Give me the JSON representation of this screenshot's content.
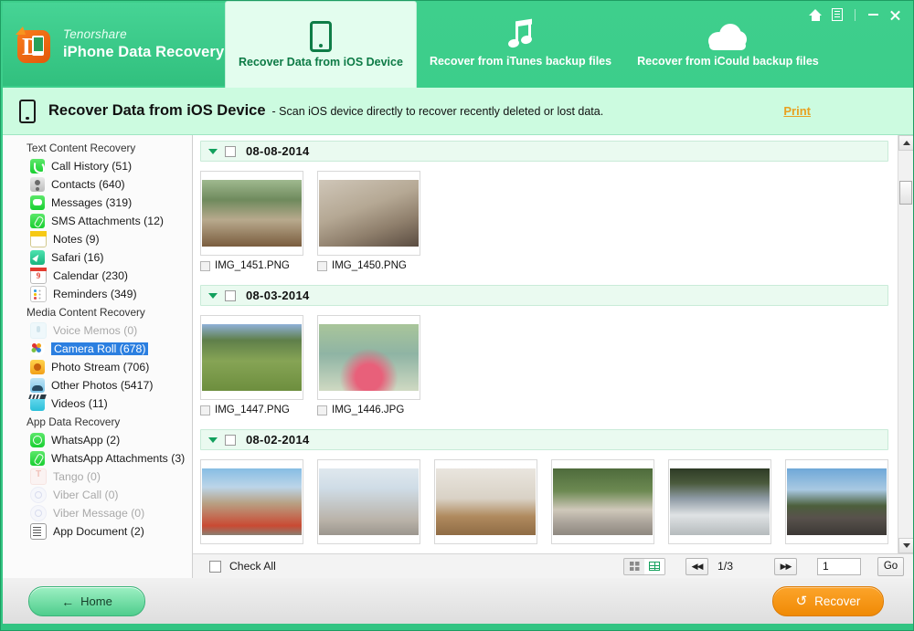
{
  "brand": {
    "company": "Tenorshare",
    "product": "iPhone Data Recovery",
    "logo_icon": "tenorshare-d-logo-icon"
  },
  "window_controls": [
    {
      "name": "home-icon",
      "label": ""
    },
    {
      "name": "document-icon",
      "label": ""
    },
    {
      "name": "minimize-icon",
      "label": ""
    },
    {
      "name": "close-icon",
      "label": ""
    }
  ],
  "tabs": [
    {
      "label": "Recover Data from iOS Device",
      "icon": "phone-icon",
      "active": true
    },
    {
      "label": "Recover from iTunes backup files",
      "icon": "music-note-icon",
      "active": false
    },
    {
      "label": "Recover from iCould backup files",
      "icon": "cloud-icon",
      "active": false
    }
  ],
  "subheader": {
    "icon": "phone-icon",
    "title": "Recover Data from iOS Device",
    "description": "- Scan iOS device directly to recover recently deleted or lost data.",
    "print_label": "Print"
  },
  "sidebar": {
    "groups": [
      {
        "title": "Text Content Recovery",
        "items": [
          {
            "label": "Call History (51)",
            "icon": "call-history-icon",
            "state": "normal"
          },
          {
            "label": "Contacts (640)",
            "icon": "contacts-icon",
            "state": "normal"
          },
          {
            "label": "Messages (319)",
            "icon": "messages-icon",
            "state": "normal"
          },
          {
            "label": "SMS Attachments (12)",
            "icon": "sms-attachments-icon",
            "state": "normal"
          },
          {
            "label": "Notes (9)",
            "icon": "notes-icon",
            "state": "normal"
          },
          {
            "label": "Safari (16)",
            "icon": "safari-icon",
            "state": "normal"
          },
          {
            "label": "Calendar (230)",
            "icon": "calendar-icon",
            "state": "normal"
          },
          {
            "label": "Reminders (349)",
            "icon": "reminders-icon",
            "state": "normal"
          }
        ]
      },
      {
        "title": "Media Content Recovery",
        "items": [
          {
            "label": "Voice Memos (0)",
            "icon": "voice-memos-icon",
            "state": "disabled"
          },
          {
            "label": "Camera Roll (678)",
            "icon": "camera-roll-icon",
            "state": "selected"
          },
          {
            "label": "Photo Stream (706)",
            "icon": "photo-stream-icon",
            "state": "normal"
          },
          {
            "label": "Other Photos (5417)",
            "icon": "other-photos-icon",
            "state": "normal"
          },
          {
            "label": "Videos (11)",
            "icon": "videos-icon",
            "state": "normal"
          }
        ]
      },
      {
        "title": "App Data Recovery",
        "items": [
          {
            "label": "WhatsApp (2)",
            "icon": "whatsapp-icon",
            "state": "normal"
          },
          {
            "label": "WhatsApp Attachments (3)",
            "icon": "whatsapp-attachments-icon",
            "state": "normal"
          },
          {
            "label": "Tango (0)",
            "icon": "tango-icon",
            "state": "disabled"
          },
          {
            "label": "Viber Call (0)",
            "icon": "viber-call-icon",
            "state": "disabled"
          },
          {
            "label": "Viber Message (0)",
            "icon": "viber-message-icon",
            "state": "disabled"
          },
          {
            "label": "App Document (2)",
            "icon": "app-document-icon",
            "state": "normal"
          }
        ]
      }
    ]
  },
  "content": {
    "groups": [
      {
        "date": "08-08-2014",
        "checked": false,
        "items": [
          {
            "name": "IMG_1451.PNG",
            "checked": false,
            "thumb": "elderly-couple-on-porch"
          },
          {
            "name": "IMG_1450.PNG",
            "checked": false,
            "thumb": "family-at-dinner-table"
          }
        ]
      },
      {
        "date": "08-03-2014",
        "checked": false,
        "items": [
          {
            "name": "IMG_1447.PNG",
            "checked": false,
            "thumb": "family-with-stroller-in-park"
          },
          {
            "name": "IMG_1446.JPG",
            "checked": false,
            "thumb": "two-girls-with-camera"
          }
        ]
      },
      {
        "date": "08-02-2014",
        "checked": false,
        "items": [
          {
            "name": "",
            "checked": false,
            "thumb": "town-square-with-red-bus"
          },
          {
            "name": "",
            "checked": false,
            "thumb": "carnival-dancers-in-costume"
          },
          {
            "name": "",
            "checked": false,
            "thumb": "children-playing-indoors"
          },
          {
            "name": "",
            "checked": false,
            "thumb": "house-behind-stone-wall"
          },
          {
            "name": "",
            "checked": false,
            "thumb": "suburban-house-with-trees"
          },
          {
            "name": "",
            "checked": false,
            "thumb": "palm-lined-road"
          }
        ]
      }
    ],
    "toolbar": {
      "check_all_label": "Check All",
      "check_all_checked": false,
      "view_grid_icon": "grid-view-icon",
      "view_list_icon": "list-view-icon",
      "view_selected": "list",
      "prev_icon": "first-page-icon",
      "next_icon": "last-page-icon",
      "page_indicator": "1/3",
      "page_input_value": "1",
      "go_label": "Go"
    }
  },
  "footer": {
    "home_label": "Home",
    "home_icon": "arrow-left-icon",
    "recover_label": "Recover",
    "recover_icon": "refresh-icon"
  },
  "colors": {
    "brand_green": "#3ecf8c",
    "subheader_green": "#ccfbe0",
    "selection_blue": "#2b7fe0",
    "print_orange": "#e8a020",
    "recover_orange": "#f08a05"
  }
}
